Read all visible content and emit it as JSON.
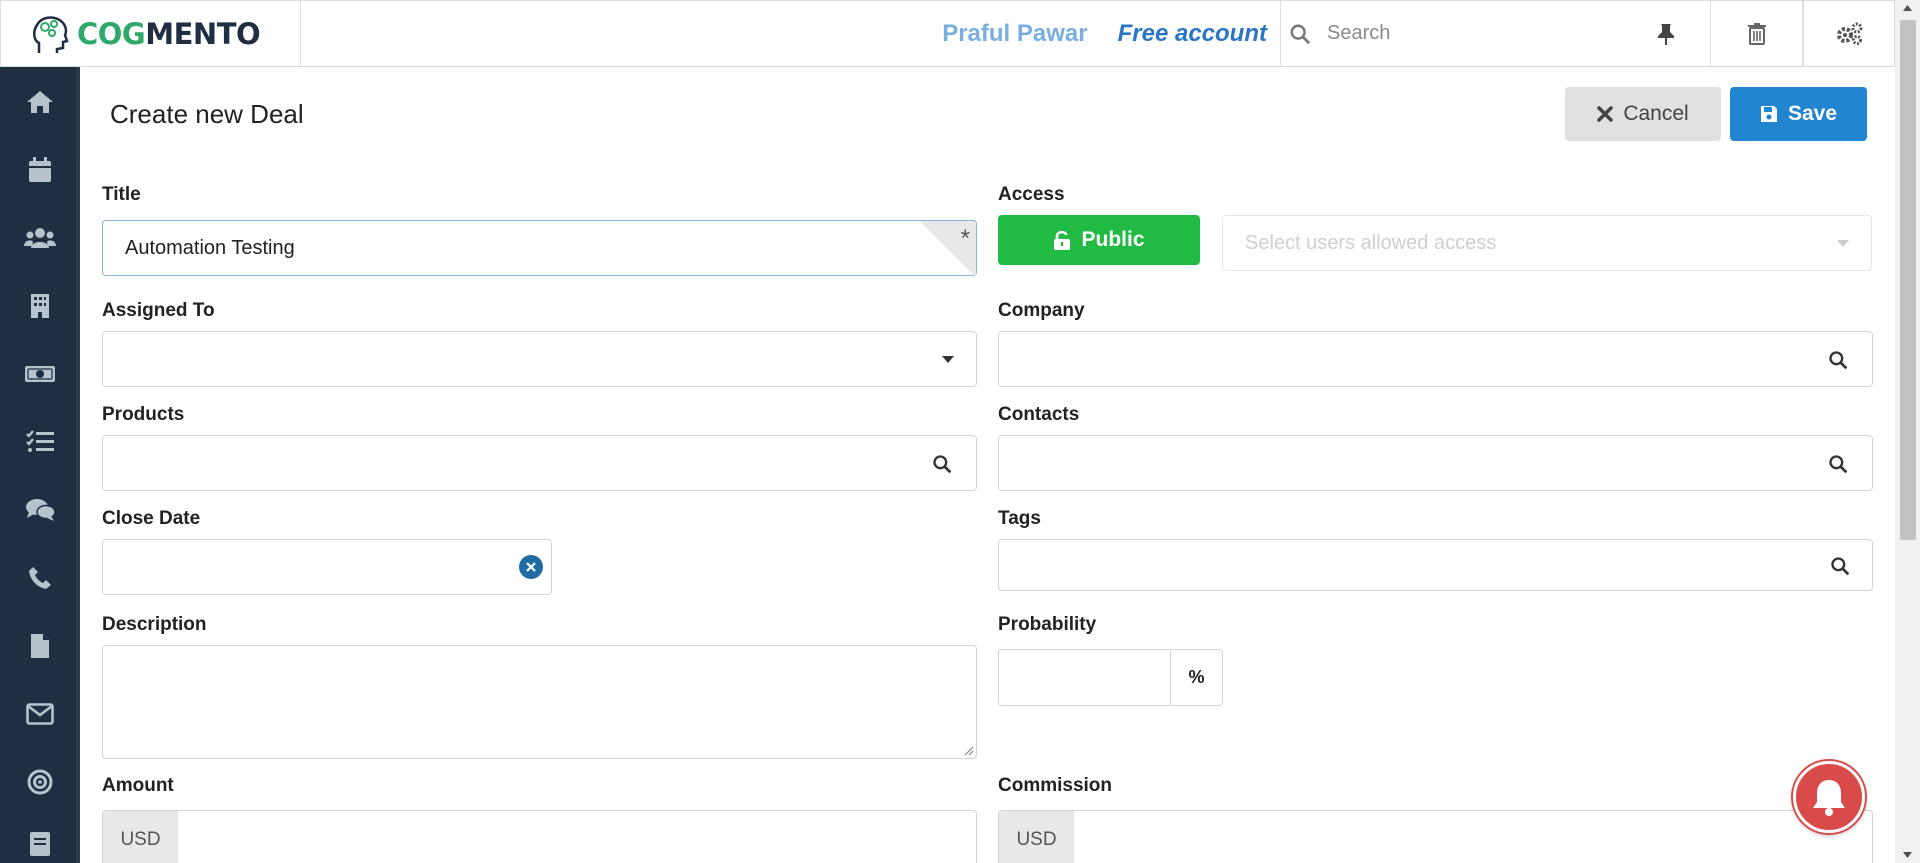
{
  "app": {
    "brand_part1": "COG",
    "brand_part2": "MENTO"
  },
  "topbar": {
    "user_name": "Praful Pawar",
    "account_type": "Free account",
    "search_placeholder": "Search"
  },
  "sidebar": {
    "items": [
      "home",
      "calendar",
      "contacts",
      "companies",
      "deals",
      "tasks",
      "cases",
      "calls",
      "documents",
      "email",
      "campaigns",
      "forms"
    ]
  },
  "header": {
    "title": "Create new Deal",
    "cancel_label": "Cancel",
    "save_label": "Save"
  },
  "form": {
    "title_label": "Title",
    "title_value": "Automation Testing",
    "required_marker": "*",
    "access_label": "Access",
    "public_label": "Public",
    "access_users_placeholder": "Select users allowed access",
    "assigned_to_label": "Assigned To",
    "company_label": "Company",
    "products_label": "Products",
    "contacts_label": "Contacts",
    "close_date_label": "Close Date",
    "tags_label": "Tags",
    "description_label": "Description",
    "probability_label": "Probability",
    "probability_unit": "%",
    "amount_label": "Amount",
    "amount_currency": "USD",
    "commission_label": "Commission",
    "commission_currency": "USD"
  },
  "colors": {
    "sidebar_bg": "#1f2e42",
    "save_button": "#2185d0",
    "public_button": "#21ba45",
    "notification_bell": "#d94b4b"
  }
}
